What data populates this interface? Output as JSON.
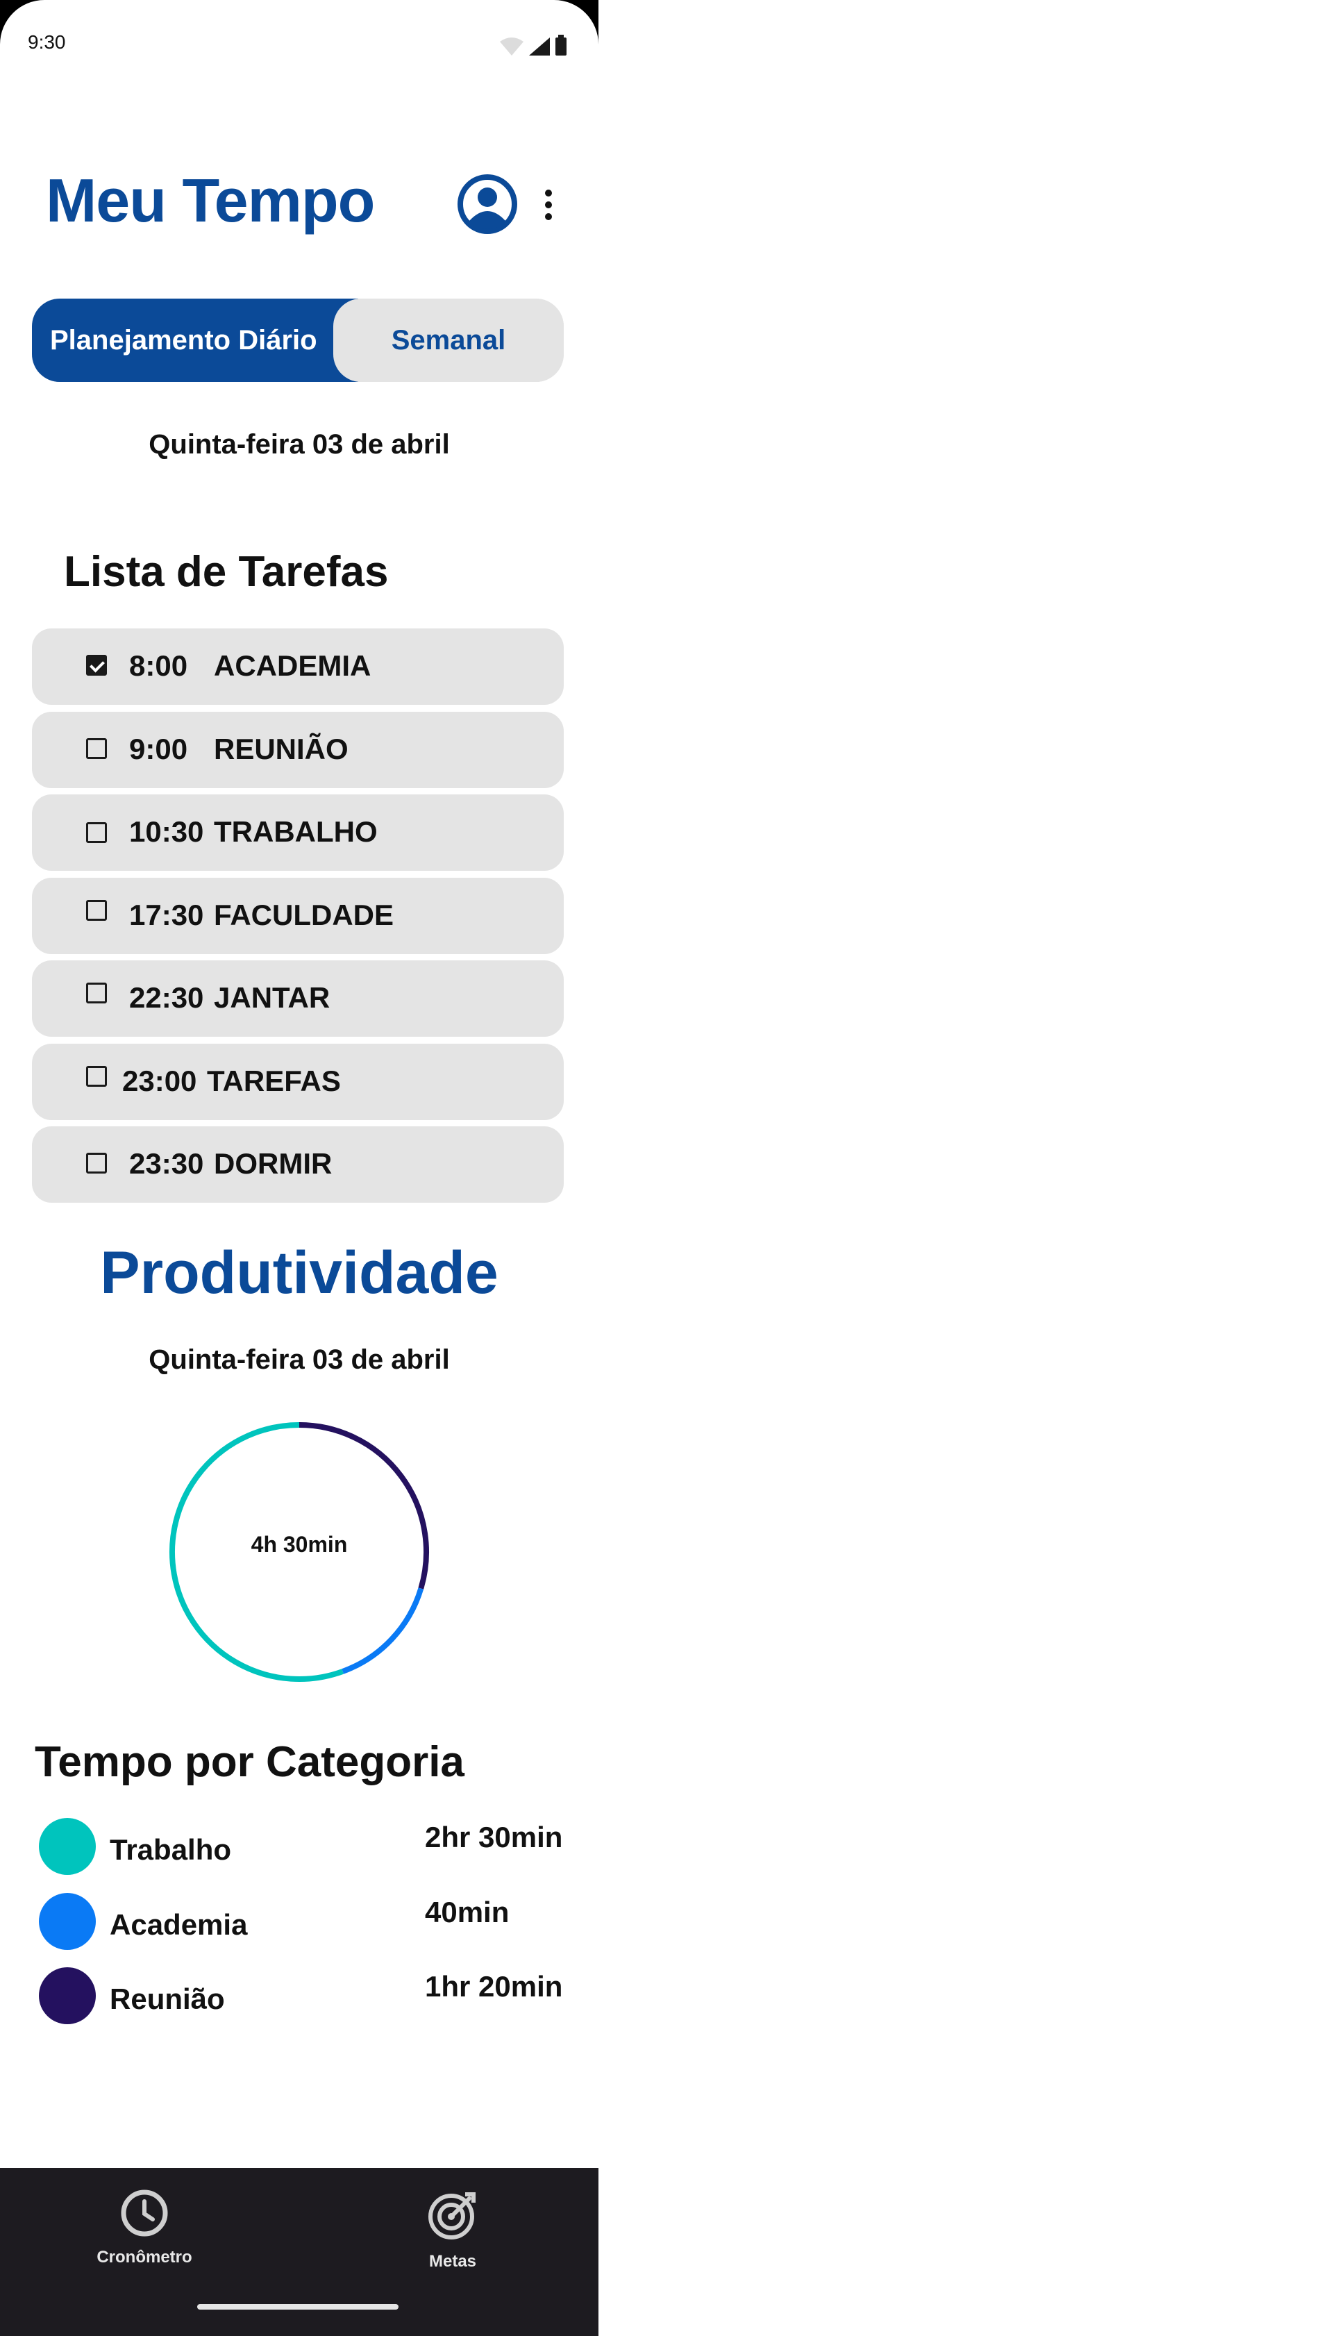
{
  "status_bar": {
    "time": "9:30"
  },
  "header": {
    "title": "Meu Tempo"
  },
  "segmented": {
    "daily_label": "Planejamento Diário",
    "weekly_label": "Semanal"
  },
  "date": "Quinta-feira 03 de abril",
  "tasks_section": {
    "title": "Lista de Tarefas",
    "items": [
      {
        "time": "8:00",
        "name": "ACADEMIA",
        "checked": true
      },
      {
        "time": "9:00",
        "name": "REUNIÃO",
        "checked": false
      },
      {
        "time": "10:30",
        "name": "TRABALHO",
        "checked": false
      },
      {
        "time": "17:30",
        "name": "FACULDADE",
        "checked": false
      },
      {
        "time": "22:30",
        "name": "JANTAR",
        "checked": false
      },
      {
        "time": "23:00",
        "name": "TAREFAS",
        "checked": false
      },
      {
        "time": "23:30",
        "name": "DORMIR",
        "checked": false
      }
    ]
  },
  "productivity": {
    "title": "Produtividade",
    "date": "Quinta-feira 03 de abril",
    "total": "4h 30min"
  },
  "chart_data": {
    "type": "pie",
    "variant": "donut",
    "center_label": "4h 30min",
    "categories": [
      "Trabalho",
      "Academia",
      "Reunião"
    ],
    "values_minutes": [
      150,
      40,
      80
    ],
    "colors": [
      "#00c4bd",
      "#0a7af5",
      "#24115f"
    ]
  },
  "categories_section": {
    "title": "Tempo por Categoria",
    "items": [
      {
        "name": "Trabalho",
        "time": "2hr 30min",
        "color": "#00c4bd"
      },
      {
        "name": "Academia",
        "time": "40min",
        "color": "#0a7af5"
      },
      {
        "name": "Reunião",
        "time": "1hr 20min",
        "color": "#24115f"
      }
    ]
  },
  "bottom_nav": {
    "items": [
      {
        "label": "Cronômetro",
        "icon": "clock-icon"
      },
      {
        "label": "Metas",
        "icon": "target-icon"
      }
    ]
  }
}
